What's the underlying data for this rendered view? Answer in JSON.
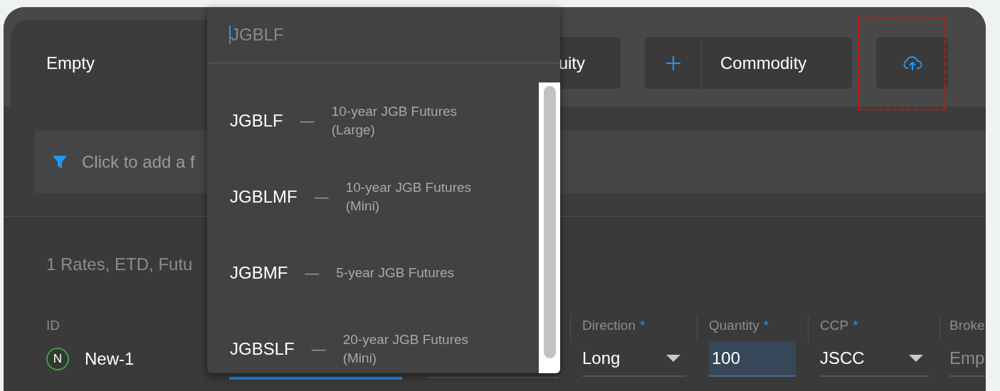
{
  "header": {
    "tabs": [
      {
        "label": "Empty",
        "selected": true,
        "kind": "tab"
      },
      {
        "label": "uity",
        "selected": false,
        "kind": "button"
      },
      {
        "label": "Commodity",
        "selected": false,
        "kind": "add-button"
      }
    ],
    "upload_button": {
      "highlighted": true
    }
  },
  "filter_bar": {
    "placeholder": "Click to add a f"
  },
  "section": {
    "title": "1 Rates, ETD, Futu",
    "columns": [
      {
        "kind": "id",
        "label": "ID",
        "badge": "N",
        "value": "New-1"
      },
      {
        "kind": "blank",
        "focused": true
      },
      {
        "kind": "blank",
        "focused": false
      },
      {
        "kind": "select",
        "label": "Direction",
        "required_mark": "*",
        "value": "Long"
      },
      {
        "kind": "number",
        "label": "Quantity",
        "required_mark": "*",
        "value": "100",
        "selected": true
      },
      {
        "kind": "select",
        "label": "CCP",
        "required_mark": "*",
        "value": "JSCC"
      },
      {
        "kind": "text",
        "label": "Broke",
        "placeholder": "Emp"
      }
    ]
  },
  "dropdown": {
    "search_placeholder": "JGBLF",
    "items": [
      {
        "code": "JGBLF",
        "separator": "—",
        "description": "10-year JGB Futures (Large)"
      },
      {
        "code": "JGBLMF",
        "separator": "—",
        "description": "10-year JGB Futures (Mini)"
      },
      {
        "code": "JGBMF",
        "separator": "—",
        "description": "5-year JGB Futures"
      },
      {
        "code": "JGBSLF",
        "separator": "—",
        "description": "20-year JGB Futures (Mini)"
      }
    ]
  }
}
